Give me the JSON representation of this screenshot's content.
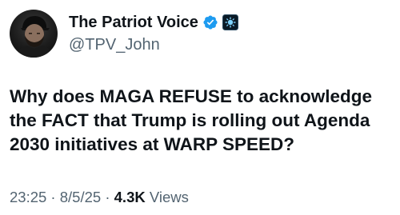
{
  "author": {
    "display_name": "The Patriot Voice",
    "handle": "@TPV_John",
    "avatar": "profile-photo",
    "badges": [
      "verified-check-icon",
      "affiliate-badge-icon"
    ]
  },
  "post": {
    "text": "Why does MAGA REFUSE to acknowledge\nthe FACT that Trump is rolling out Agenda\n2030 initiatives at WARP SPEED?"
  },
  "meta": {
    "time": "23:25",
    "sep1": " · ",
    "date": "8/5/25",
    "sep2": " · ",
    "views_count": "4.3K",
    "views_label": " Views"
  },
  "colors": {
    "verified_blue": "#1d9bf0",
    "text_primary": "#0f1419",
    "text_secondary": "#536471"
  }
}
